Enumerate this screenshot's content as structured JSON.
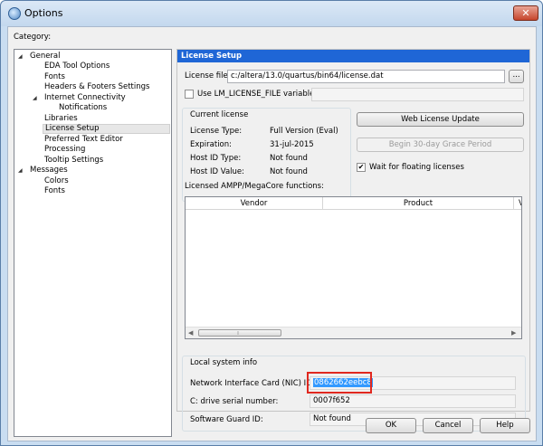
{
  "window": {
    "title": "Options"
  },
  "category_label": "Category:",
  "tree": [
    {
      "label": "General",
      "expander": "◢"
    },
    {
      "label": "EDA Tool Options"
    },
    {
      "label": "Fonts"
    },
    {
      "label": "Headers & Footers Settings"
    },
    {
      "label": "Internet Connectivity",
      "expander": "◢"
    },
    {
      "label": "Notifications"
    },
    {
      "label": "Libraries"
    },
    {
      "label": "License Setup",
      "selected": true
    },
    {
      "label": "Preferred Text Editor"
    },
    {
      "label": "Processing"
    },
    {
      "label": "Tooltip Settings"
    },
    {
      "label": "Messages",
      "expander": "◢"
    },
    {
      "label": "Colors"
    },
    {
      "label": "Fonts"
    }
  ],
  "panel": {
    "header": "License Setup",
    "license_file_label": "License file:",
    "license_file_value": "c:/altera/13.0/quartus/bin64/license.dat",
    "browse_label": "...",
    "use_env_label": "Use LM_LICENSE_FILE variable:",
    "current_license": {
      "title": "Current license",
      "rows": [
        {
          "label": "License Type:",
          "value": "Full Version (Eval)"
        },
        {
          "label": "Expiration:",
          "value": "31-jul-2015"
        },
        {
          "label": "Host ID Type:",
          "value": "Not found"
        },
        {
          "label": "Host ID Value:",
          "value": "Not found"
        }
      ]
    },
    "web_update_label": "Web License Update",
    "grace_period_label": "Begin 30-day Grace Period",
    "wait_label": "Wait for floating licenses",
    "wait_checked": true,
    "ampp_label": "Licensed AMPP/MegaCore functions:",
    "table_columns": [
      "Vendor",
      "Product",
      "V"
    ],
    "local_info": {
      "title": "Local system info",
      "nic_label": "Network Interface Card (NIC) ID:",
      "nic_value": "0862662eebc8",
      "drive_label": "C: drive serial number:",
      "drive_value": "0007f652",
      "guard_label": "Software Guard ID:",
      "guard_value": "Not found"
    }
  },
  "buttons": {
    "ok": "OK",
    "cancel": "Cancel",
    "help": "Help"
  },
  "colors": {
    "header_blue": "#1f66d6",
    "highlight_red": "#e0281f",
    "selection_blue": "#3399ff"
  }
}
